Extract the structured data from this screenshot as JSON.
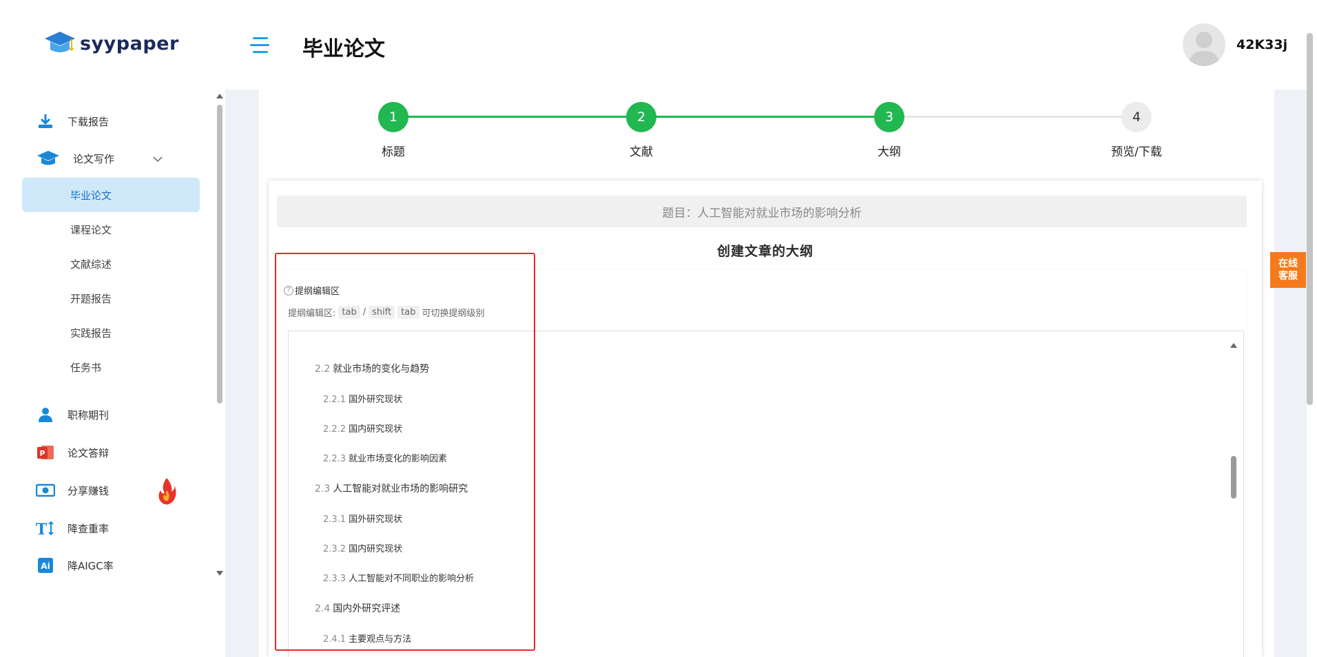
{
  "app": {
    "logo_text": "syypaper",
    "page_title": "毕业论文",
    "username": "42K33j"
  },
  "sidebar": {
    "items": [
      {
        "label": "下载报告",
        "icon": "download-icon"
      },
      {
        "label": "论文写作",
        "icon": "graduation-cap-icon",
        "expandable": true
      },
      {
        "label": "毕业论文",
        "sub": true,
        "active": true
      },
      {
        "label": "课程论文",
        "sub": true
      },
      {
        "label": "文献综述",
        "sub": true
      },
      {
        "label": "开题报告",
        "sub": true
      },
      {
        "label": "实践报告",
        "sub": true
      },
      {
        "label": "任务书",
        "sub": true
      },
      {
        "label": "职称期刊",
        "icon": "user-icon"
      },
      {
        "label": "论文答辩",
        "icon": "powerpoint-icon"
      },
      {
        "label": "分享赚钱",
        "icon": "money-icon",
        "badge": "fire-icon"
      },
      {
        "label": "降查重率",
        "icon": "text-icon"
      },
      {
        "label": "降AIGC率",
        "icon": "ai-icon"
      }
    ]
  },
  "steps": [
    {
      "num": "1",
      "label": "标题",
      "state": "done"
    },
    {
      "num": "2",
      "label": "文献",
      "state": "done"
    },
    {
      "num": "3",
      "label": "大纲",
      "state": "active"
    },
    {
      "num": "4",
      "label": "预览/下载",
      "state": "pending"
    }
  ],
  "topic": "题目：人工智能对就业市场的影响分析",
  "outline_title": "创建文章的大纲",
  "editor": {
    "heading": "提纲编辑区",
    "hint_prefix": "提纲编辑区:",
    "key1": "tab",
    "sep": "/",
    "key2": "shift",
    "key3": "tab",
    "hint_suffix": "可切换提纲级别"
  },
  "outline": [
    {
      "num": "2.2",
      "text": "就业市场的变化与趋势",
      "level": 2
    },
    {
      "num": "2.2.1",
      "text": "国外研究现状",
      "level": 3
    },
    {
      "num": "2.2.2",
      "text": "国内研究现状",
      "level": 3
    },
    {
      "num": "2.2.3",
      "text": "就业市场变化的影响因素",
      "level": 3
    },
    {
      "num": "2.3",
      "text": "人工智能对就业市场的影响研究",
      "level": 2
    },
    {
      "num": "2.3.1",
      "text": "国外研究现状",
      "level": 3
    },
    {
      "num": "2.3.2",
      "text": "国内研究现状",
      "level": 3
    },
    {
      "num": "2.3.3",
      "text": "人工智能对不同职业的影响分析",
      "level": 3
    },
    {
      "num": "2.4",
      "text": "国内外研究评述",
      "level": 2
    },
    {
      "num": "2.4.1",
      "text": "主要观点与方法",
      "level": 3
    }
  ],
  "service": {
    "line1": "在线",
    "line2": "客服"
  },
  "colors": {
    "accent_green": "#21b751",
    "accent_blue": "#1aa0e8",
    "highlight_red": "#e8262b",
    "service_orange": "#f57a1b"
  }
}
